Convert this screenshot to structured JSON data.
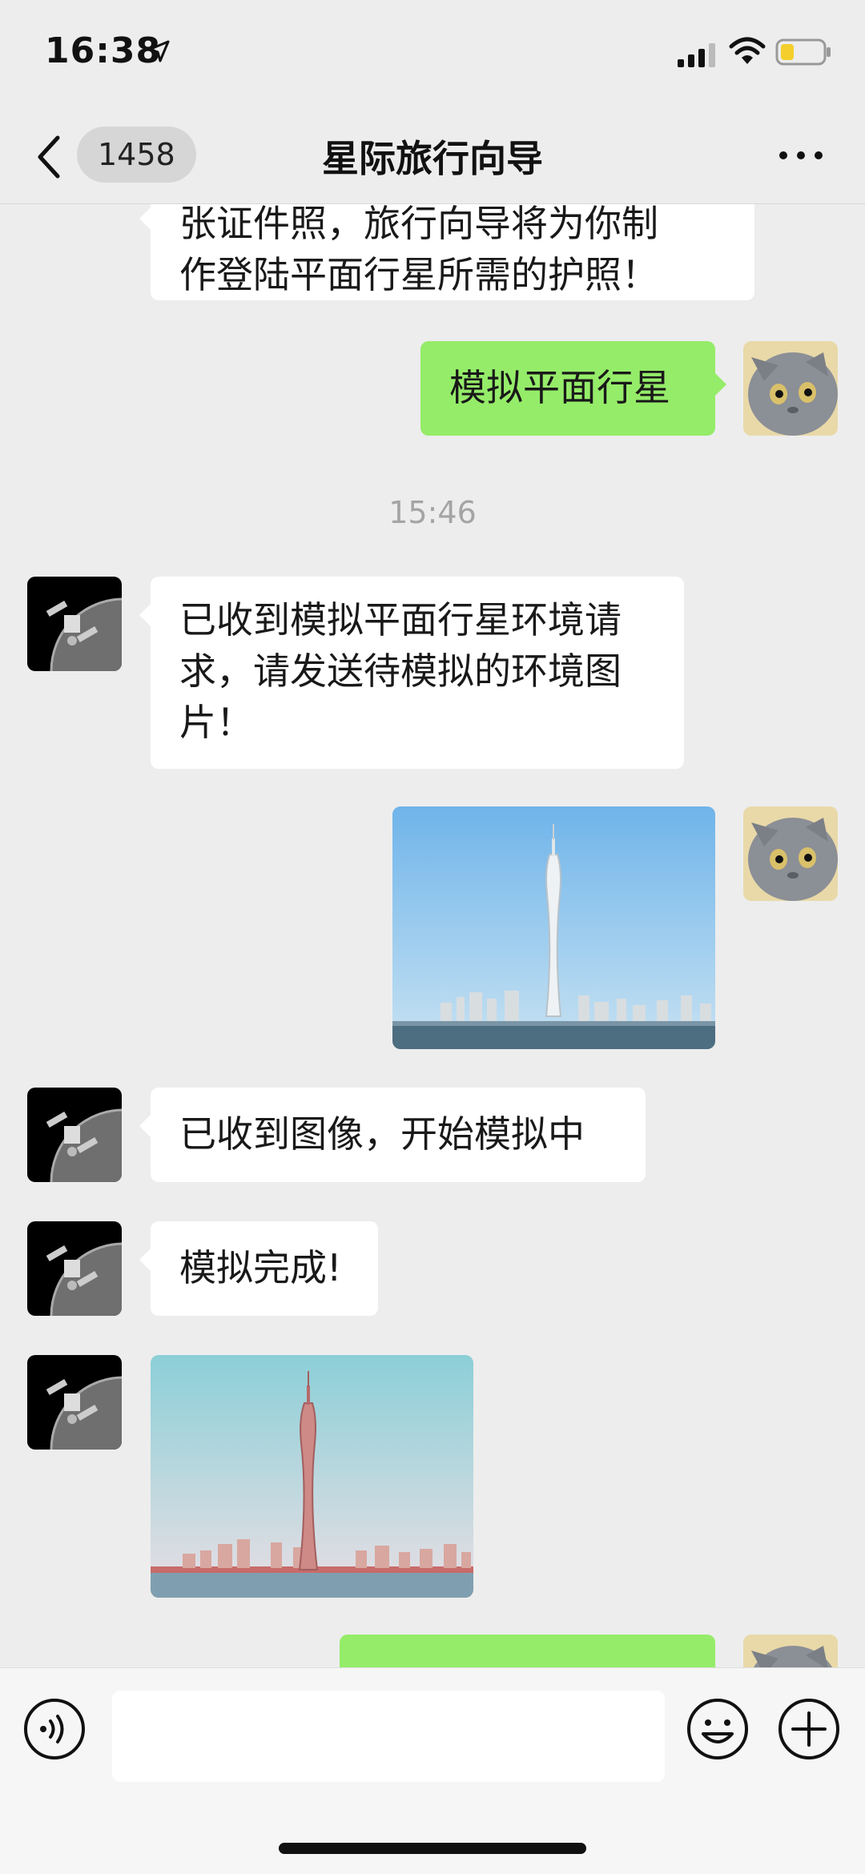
{
  "status_bar": {
    "time": "16:38"
  },
  "nav": {
    "unread_count": "1458",
    "title": "星际旅行向导"
  },
  "messages": {
    "m1_line1": "张证件照，旅行向导将为你制",
    "m1_line2": "作登陆平面行星所需的护照！",
    "m2": "模拟平面行星",
    "timestamp": "15:46",
    "m3": "已收到模拟平面行星环境请求，请发送待模拟的环境图片！",
    "m5": "已收到图像，开始模拟中",
    "m6": "模拟完成!"
  },
  "input": {
    "placeholder": ""
  },
  "colors": {
    "out_bubble": "#95ec69",
    "in_bubble": "#ffffff",
    "background": "#ededed"
  }
}
